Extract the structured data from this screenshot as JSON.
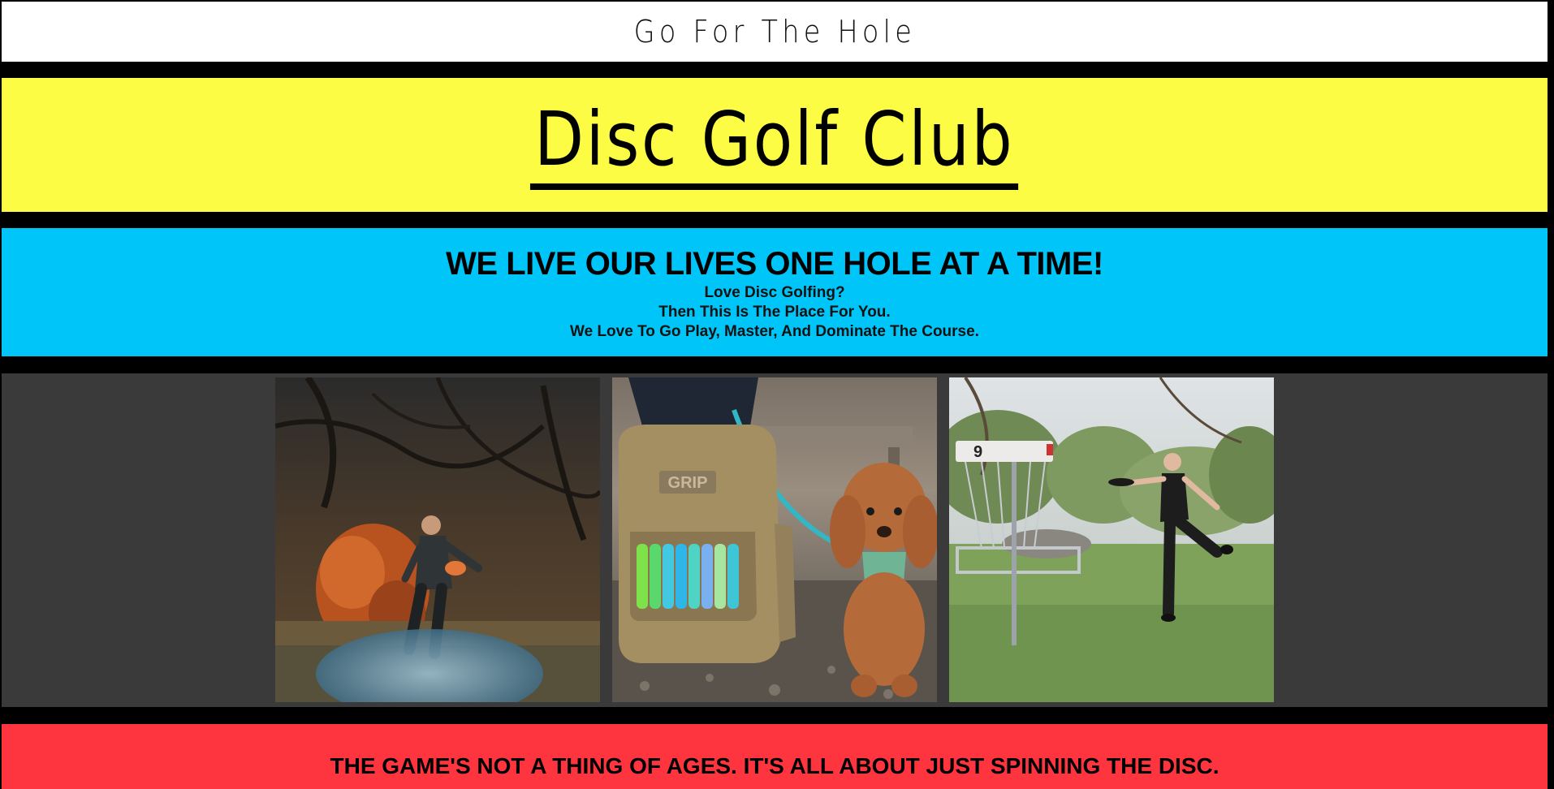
{
  "header": {
    "brand": "Go For The Hole"
  },
  "hero": {
    "title": "Disc Golf Club"
  },
  "intro": {
    "headline": "WE LIVE OUR LIVES ONE HOLE AT A TIME!",
    "line1": "Love Disc Golfing?",
    "line2": "Then This Is The Place For You.",
    "line3": "We Love To Go Play, Master, And Dominate The Course."
  },
  "gallery": {
    "photos": [
      {
        "name": "player-throwing-photo"
      },
      {
        "name": "disc-bag-and-poodle-photo"
      },
      {
        "name": "basket-throw-photo"
      }
    ],
    "bag_brand": "GRIP",
    "basket_number": "9"
  },
  "footer_band": {
    "tagline": "THE GAME'S NOT A THING OF AGES. IT'S ALL ABOUT JUST SPINNING THE DISC."
  },
  "colors": {
    "yellow": "#fbfc43",
    "blue": "#00c5f9",
    "red": "#fe343e",
    "gallery_bg": "#3a3a3a"
  }
}
